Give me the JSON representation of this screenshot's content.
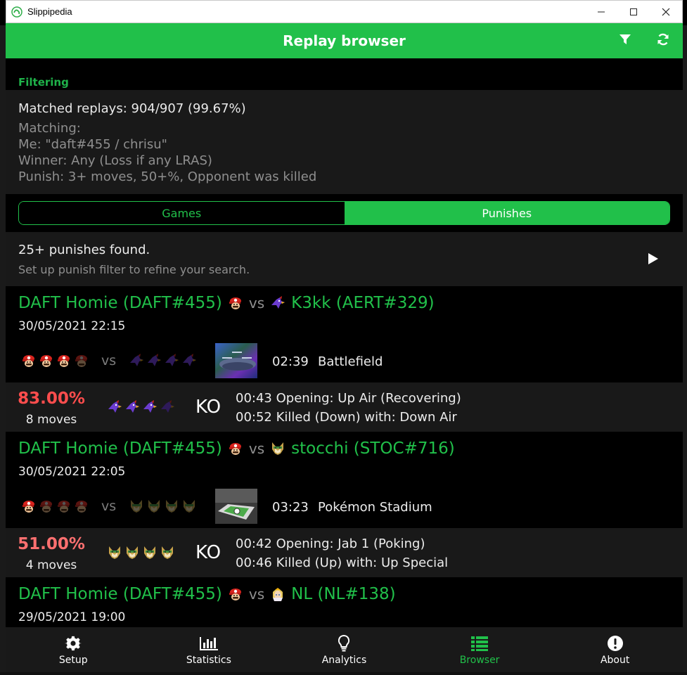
{
  "window": {
    "app_title": "Slippipedia",
    "minimize": "─",
    "maximize": "☐",
    "close": "✕"
  },
  "header": {
    "title": "Replay browser",
    "filter_icon": "filter-icon",
    "refresh_icon": "refresh-icon"
  },
  "filtering": {
    "heading": "Filtering",
    "matched": "Matched replays: 904/907 (99.67%)",
    "matching_label": "Matching:",
    "me": "Me: \"daft#455 / chrisu\"",
    "winner": "Winner: Any (Loss if any LRAS)",
    "punish": "Punish: 3+ moves, 50+%, Opponent was killed"
  },
  "tabs": [
    {
      "label": "Games",
      "selected": false
    },
    {
      "label": "Punishes",
      "selected": true
    }
  ],
  "results": {
    "title": "25+ punishes found.",
    "subtitle": "Set up punish filter to refine your search.",
    "play_icon": "play-icon"
  },
  "games": [
    {
      "player": "DAFT Homie (DAFT#455)",
      "player_char": "mario",
      "vs": "vs",
      "opponent": "K3kk (AERT#329)",
      "opponent_char": "falco",
      "date": "30/05/2021 22:15",
      "player_stocks": 4,
      "player_stocks_remaining": 3,
      "opponent_stocks": 4,
      "opponent_stocks_remaining": 0,
      "duration": "02:39",
      "stage": "Battlefield",
      "punish": {
        "percent": "83.00%",
        "percent_color": "#ff4d4d",
        "moves": "8 moves",
        "stocks": 4,
        "stocks_remaining": 3,
        "result": "KO",
        "opening": "00:43 Opening: Up Air (Recovering)",
        "kill": "00:52 Killed (Down) with: Down Air"
      }
    },
    {
      "player": "DAFT Homie (DAFT#455)",
      "player_char": "mario",
      "vs": "vs",
      "opponent": "stocchi (STOC#716)",
      "opponent_char": "fox",
      "date": "30/05/2021 22:05",
      "player_stocks": 4,
      "player_stocks_remaining": 1,
      "opponent_stocks": 4,
      "opponent_stocks_remaining": 0,
      "duration": "03:23",
      "stage": "Pokémon Stadium",
      "punish": {
        "percent": "51.00%",
        "percent_color": "#ff7070",
        "moves": "4 moves",
        "stocks": 4,
        "stocks_remaining": 4,
        "result": "KO",
        "opening": "00:42 Opening: Jab 1 (Poking)",
        "kill": "00:46 Killed (Up) with: Up Special"
      }
    },
    {
      "player": "DAFT Homie (DAFT#455)",
      "player_char": "mario",
      "vs": "vs",
      "opponent": "NL (NL#138)",
      "opponent_char": "zelda",
      "date": "29/05/2021 19:00"
    }
  ],
  "nav": [
    {
      "label": "Setup",
      "icon": "gear-icon",
      "active": false
    },
    {
      "label": "Statistics",
      "icon": "bar-chart-icon",
      "active": false
    },
    {
      "label": "Analytics",
      "icon": "lightbulb-icon",
      "active": false
    },
    {
      "label": "Browser",
      "icon": "list-icon",
      "active": true
    },
    {
      "label": "About",
      "icon": "info-icon",
      "active": false
    }
  ],
  "colors": {
    "accent": "#21c04a",
    "panel": "#191919",
    "bg": "#000000"
  }
}
